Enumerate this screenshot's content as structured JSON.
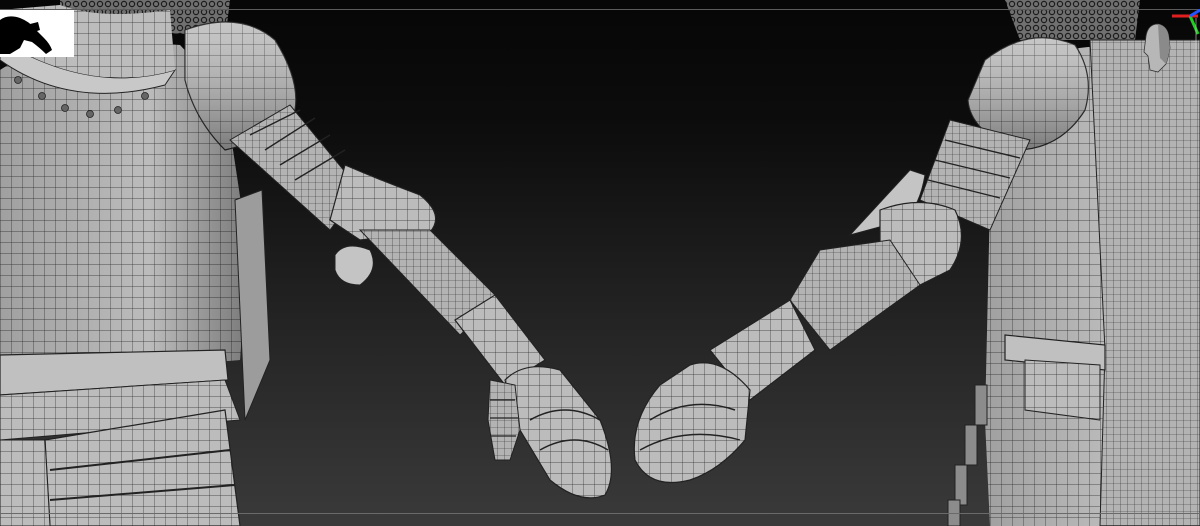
{
  "app": {
    "title": ""
  },
  "viewport": {
    "background_top": "#060606",
    "background_bottom": "#3a3a3a",
    "mesh_fill": "#b9b9b9",
    "mesh_wire": "#2a2a2a",
    "frame_color": "#5a5a5a"
  },
  "navigator": {
    "thumbnail_bg": "#ffffff",
    "silhouette_color": "#000000"
  },
  "axis_gizmo": {
    "x_color": "#e02020",
    "y_color": "#22cc22",
    "z_color": "#2255ff",
    "head_icon": "head-icon"
  }
}
